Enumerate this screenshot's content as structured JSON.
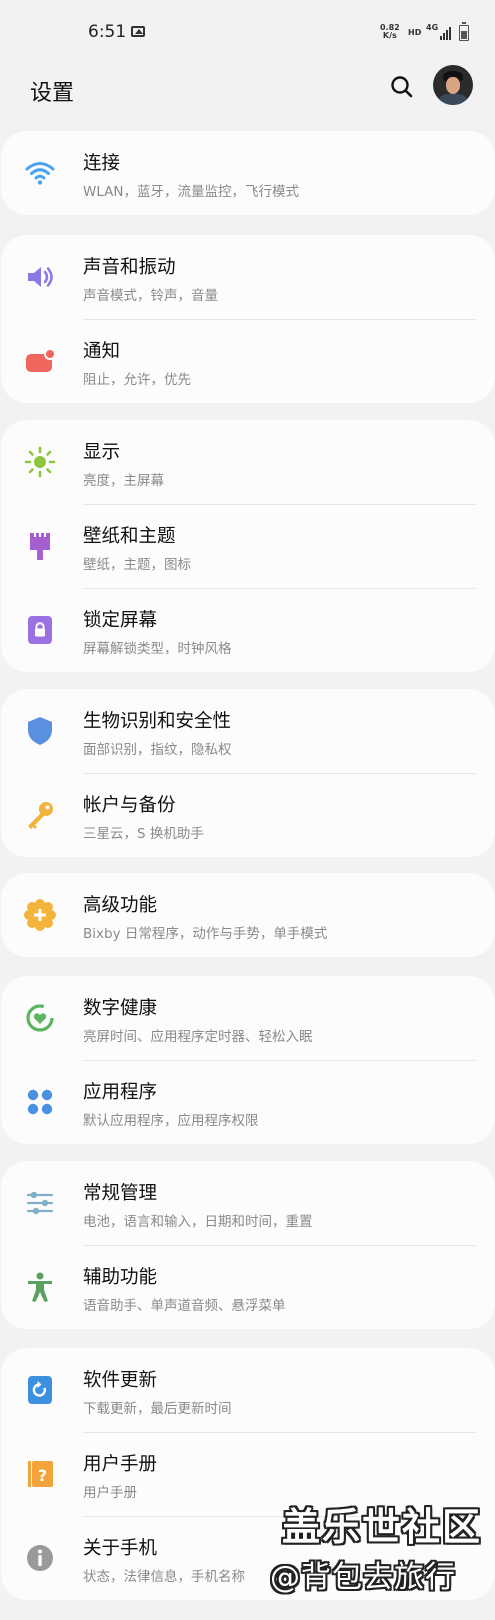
{
  "status_bar": {
    "time": "6:51",
    "speed_value": "0.82",
    "speed_unit": "K/s",
    "hd": "HD",
    "network": "4G"
  },
  "header": {
    "title": "设置"
  },
  "groups": [
    {
      "items": [
        {
          "title": "连接",
          "subtitle": "WLAN，蓝牙，流量监控，飞行模式",
          "icon": "wifi-icon",
          "color": "#4aa3f0"
        }
      ]
    },
    {
      "items": [
        {
          "title": "声音和振动",
          "subtitle": "声音模式，铃声，音量",
          "icon": "speaker-icon",
          "color": "#8a78e6"
        },
        {
          "title": "通知",
          "subtitle": "阻止，允许，优先",
          "icon": "notification-icon",
          "color": "#f0655d"
        }
      ]
    },
    {
      "items": [
        {
          "title": "显示",
          "subtitle": "亮度，主屏幕",
          "icon": "sun-icon",
          "color": "#8dc63f"
        },
        {
          "title": "壁纸和主题",
          "subtitle": "壁纸，主题，图标",
          "icon": "paintbrush-icon",
          "color": "#a55fd1"
        },
        {
          "title": "锁定屏幕",
          "subtitle": "屏幕解锁类型，时钟风格",
          "icon": "lock-icon",
          "color": "#9b70e0"
        }
      ]
    },
    {
      "items": [
        {
          "title": "生物识别和安全性",
          "subtitle": "面部识别，指纹，隐私权",
          "icon": "shield-icon",
          "color": "#5b8fe0"
        },
        {
          "title": "帐户与备份",
          "subtitle": "三星云，S 换机助手",
          "icon": "key-icon",
          "color": "#f2b33d"
        }
      ]
    },
    {
      "items": [
        {
          "title": "高级功能",
          "subtitle": "Bixby 日常程序，动作与手势，单手模式",
          "icon": "gear-plus-icon",
          "color": "#f4b43b"
        }
      ]
    },
    {
      "items": [
        {
          "title": "数字健康",
          "subtitle": "亮屏时间、应用程序定时器、轻松入眠",
          "icon": "wellbeing-icon",
          "color": "#5ab55e"
        },
        {
          "title": "应用程序",
          "subtitle": "默认应用程序，应用程序权限",
          "icon": "apps-grid-icon",
          "color": "#4a90e2"
        }
      ]
    },
    {
      "items": [
        {
          "title": "常规管理",
          "subtitle": "电池，语言和输入，日期和时间，重置",
          "icon": "sliders-icon",
          "color": "#7fb0c8"
        },
        {
          "title": "辅助功能",
          "subtitle": "语音助手、单声道音频、悬浮菜单",
          "icon": "accessibility-icon",
          "color": "#5aa05e"
        }
      ]
    },
    {
      "items": [
        {
          "title": "软件更新",
          "subtitle": "下载更新，最后更新时间",
          "icon": "update-icon",
          "color": "#3d8fe0"
        },
        {
          "title": "用户手册",
          "subtitle": "用户手册",
          "icon": "manual-icon",
          "color": "#f2a33a"
        },
        {
          "title": "关于手机",
          "subtitle": "状态，法律信息，手机名称",
          "icon": "info-icon",
          "color": "#9a9a9a"
        }
      ]
    }
  ],
  "watermark": {
    "line1": "盖乐世社区",
    "line2": "@背包去旅行"
  }
}
